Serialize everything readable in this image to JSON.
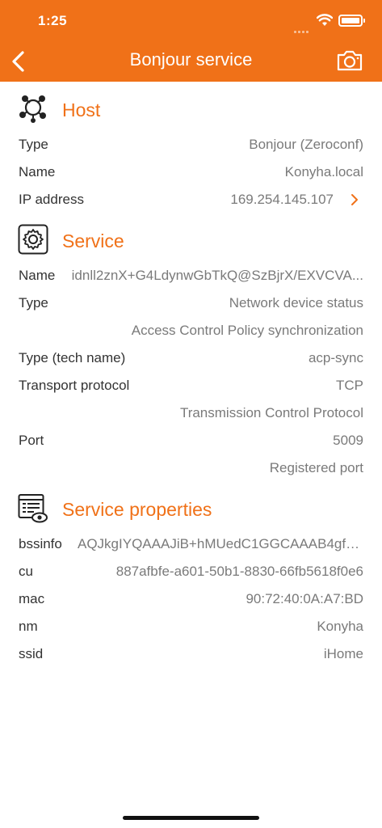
{
  "status_bar": {
    "time": "1:25"
  },
  "nav": {
    "title": "Bonjour service"
  },
  "host": {
    "title": "Host",
    "rows": [
      {
        "label": "Type",
        "value": "Bonjour (Zeroconf)"
      },
      {
        "label": "Name",
        "value": "Konyha.local"
      },
      {
        "label": "IP address",
        "value": "169.254.145.107"
      }
    ]
  },
  "service": {
    "title": "Service",
    "name_label": "Name",
    "name_value": "idnll2znX+G4LdynwGbTkQ@SzBjrX/EXVCVA...",
    "type_label": "Type",
    "type_value": "Network device status",
    "type_value2": "Access Control Policy synchronization",
    "tech_label": "Type (tech name)",
    "tech_value": "acp-sync",
    "transport_label": "Transport protocol",
    "transport_value": "TCP",
    "transport_value2": "Transmission Control Protocol",
    "port_label": "Port",
    "port_value": "5009",
    "port_value2": "Registered port"
  },
  "properties": {
    "title": "Service properties",
    "rows": [
      {
        "label": "bssinfo",
        "value": "AQJkgIYQAAAJiB+hMUedC1GGCAAAB4gfo..."
      },
      {
        "label": "cu",
        "value": "887afbfe-a601-50b1-8830-66fb5618f0e6"
      },
      {
        "label": "mac",
        "value": "90:72:40:0A:A7:BD"
      },
      {
        "label": "nm",
        "value": "Konyha"
      },
      {
        "label": "ssid",
        "value": "iHome"
      }
    ]
  },
  "colors": {
    "accent": "#f07118",
    "label": "#333333",
    "value": "#7a7a7a"
  },
  "icons": [
    "back-chevron-icon",
    "camera-icon",
    "host-network-icon",
    "service-gear-icon",
    "properties-list-eye-icon",
    "chevron-right-icon"
  ]
}
